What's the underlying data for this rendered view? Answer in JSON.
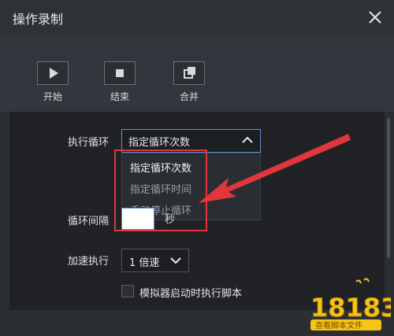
{
  "window": {
    "title": "操作录制"
  },
  "toolbar": {
    "start_label": "开始",
    "end_label": "结束",
    "merge_label": "合并"
  },
  "settings": {
    "loop_label": "执行循环",
    "loop_selected": "指定循环次数",
    "loop_options": [
      "指定循环次数",
      "指定循环时间",
      "手动停止循环"
    ],
    "interval_label": "循环间隔",
    "interval_unit": "秒",
    "speed_label": "加速执行",
    "speed_value": "1 倍速",
    "startup_checkbox_label": "模拟器启动时执行脚本",
    "startup_checked": false
  },
  "watermark": {
    "brand": "18183",
    "sub": "查看脚本文件"
  },
  "colors": {
    "accent": "#5d8fd8",
    "annotation_red": "#e0363c",
    "panel": "#202226"
  }
}
